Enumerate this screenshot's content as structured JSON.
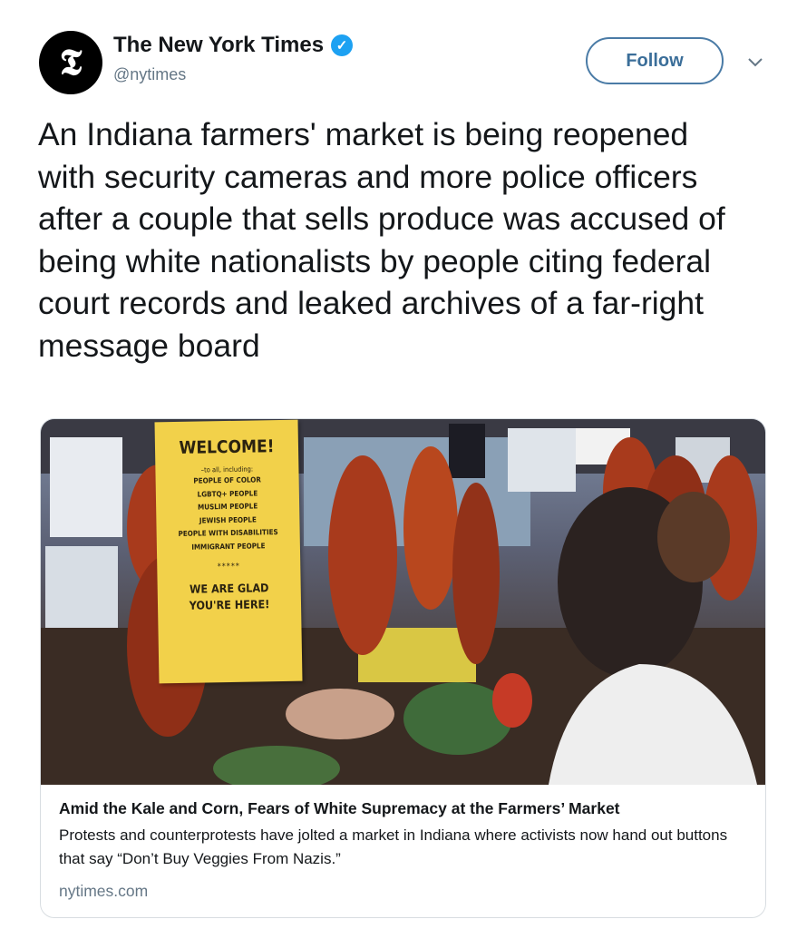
{
  "account": {
    "avatar_glyph": "𝕿",
    "display_name": "The New York Times",
    "verified_glyph": "✓",
    "handle": "@nytimes",
    "follow_label": "Follow"
  },
  "tweet": {
    "text": "An Indiana farmers' market is being reopened with security cameras and more police officers after a couple that sells produce was accused of being white nationalists by people citing federal court records and leaked archives of a far-right message board"
  },
  "card": {
    "image_sign": {
      "title": "WELCOME!",
      "sub": "–to all, including:",
      "items": [
        "PEOPLE OF COLOR",
        "LGBTQ+ PEOPLE",
        "MUSLIM PEOPLE",
        "JEWISH PEOPLE",
        "PEOPLE WITH DISABILITIES",
        "IMMIGRANT PEOPLE"
      ],
      "divider": "*****",
      "bottom_line1": "WE ARE GLAD",
      "bottom_line2": "YOU'RE HERE!"
    },
    "title": "Amid the Kale and Corn, Fears of White Supremacy at the Farmers’ Market",
    "description": "Protests and counterprotests have jolted a market in Indiana where activists now hand out buttons that say “Don’t Buy Veggies From Nazis.”",
    "domain": "nytimes.com"
  },
  "colors": {
    "link_blue": "#1da1f2",
    "follow_border": "#4a7ba6",
    "secondary_text": "#657786",
    "sign_yellow": "#f2d14a"
  },
  "icons": [
    "nyt-logo-icon",
    "verified-badge-icon",
    "chevron-down-icon"
  ]
}
